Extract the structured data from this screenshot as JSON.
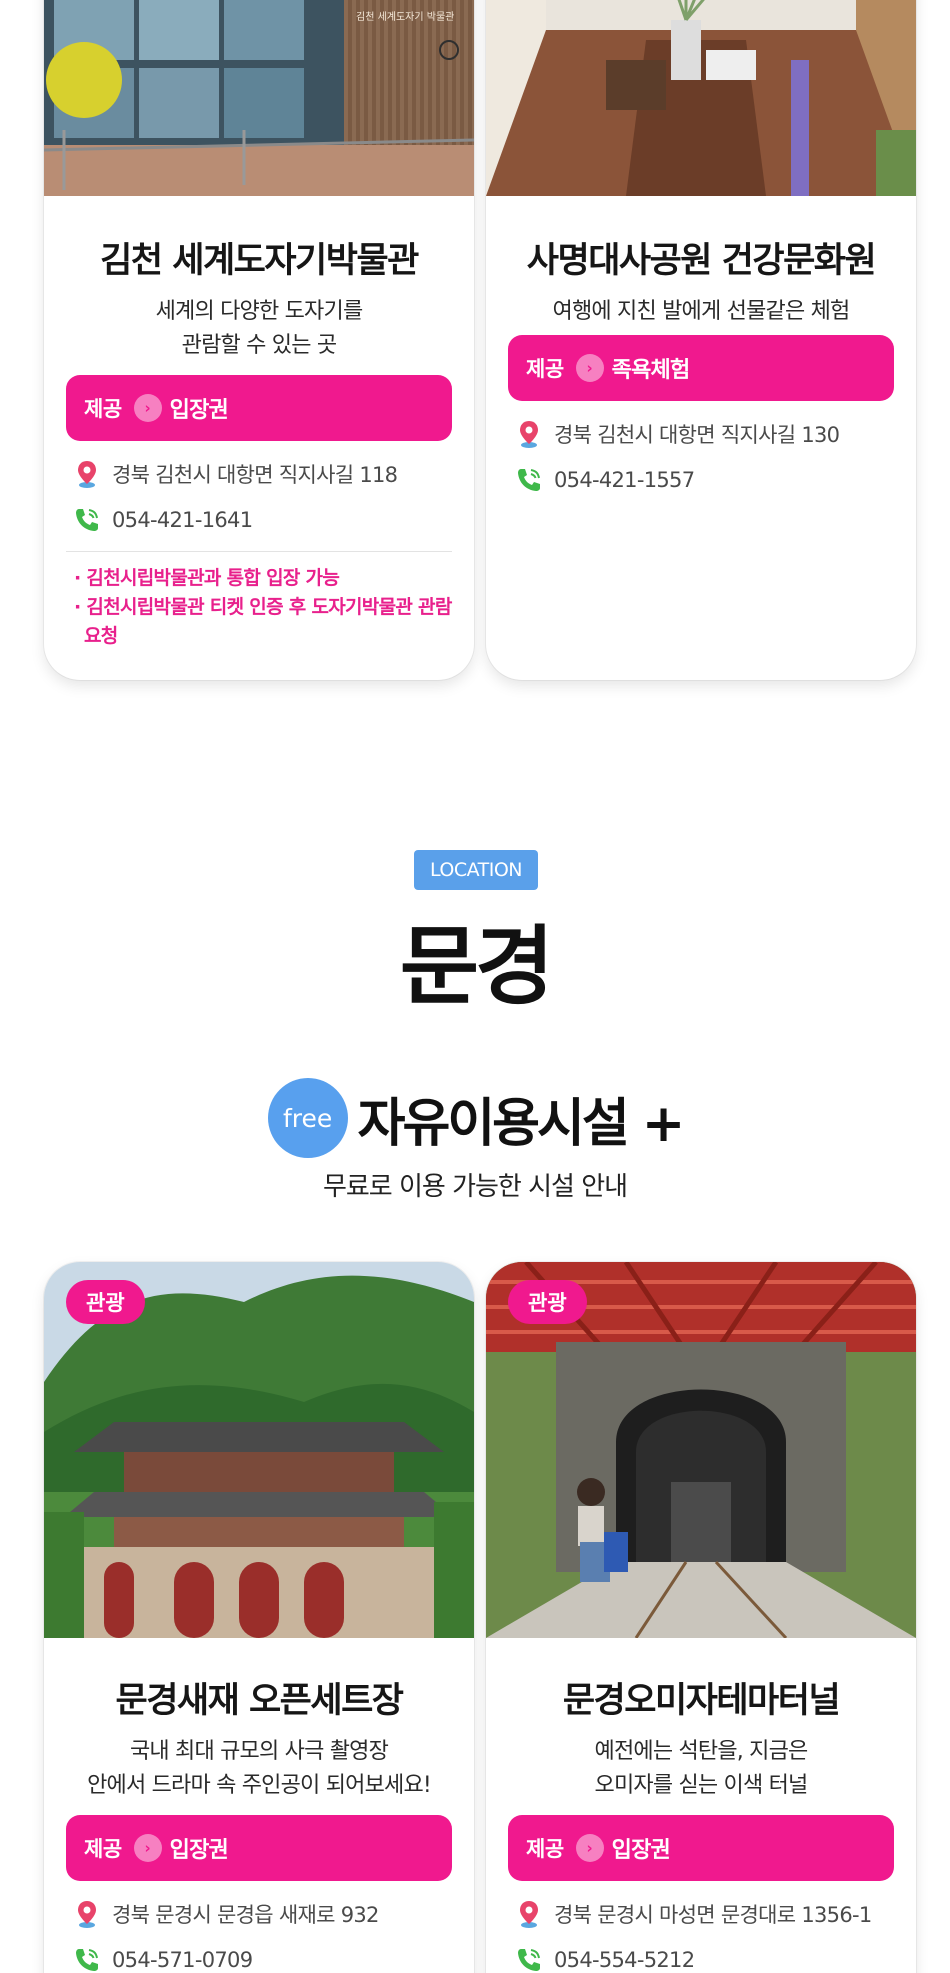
{
  "cards_top": [
    {
      "title": "김천 세계도자기박물관",
      "desc_lines": [
        "세계의 다양한 도자기를",
        "관람할 수 있는 곳"
      ],
      "provide_label": "제공",
      "provide_value": "입장권",
      "address": "경북 김천시 대항면 직지사길 118",
      "phone": "054-421-1641",
      "notes": [
        "· 김천시립박물관과 통합 입장 가능",
        "· 김천시립박물관 티켓 인증 후 도자기박물관 관람 요청"
      ]
    },
    {
      "title": "사명대사공원 건강문화원",
      "desc_lines": [
        "여행에 지친 발에게 선물같은 체험"
      ],
      "provide_label": "제공",
      "provide_value": "족욕체험",
      "address": "경북 김천시 대항면 직지사길 130",
      "phone": "054-421-1557"
    }
  ],
  "location": {
    "badge": "LOCATION",
    "region": "문경"
  },
  "free_section": {
    "badge": "free",
    "title": "자유이용시설 +",
    "subtitle": "무료로 이용 가능한 시설 안내"
  },
  "cards_bottom": [
    {
      "tag": "관광",
      "title": "문경새재 오픈세트장",
      "desc_lines": [
        "국내 최대 규모의 사극 촬영장",
        "안에서 드라마 속 주인공이 되어보세요!"
      ],
      "provide_label": "제공",
      "provide_value": "입장권",
      "address": "경북 문경시 문경읍 새재로 932",
      "phone": "054-571-0709"
    },
    {
      "tag": "관광",
      "title": "문경오미자테마터널",
      "desc_lines": [
        "예전에는 석탄을, 지금은",
        "오미자를 싣는 이색 터널"
      ],
      "provide_label": "제공",
      "provide_value": "입장권",
      "address": "경북 문경시 마성면 문경대로 1356-1",
      "phone": "054-554-5212"
    }
  ],
  "colors": {
    "accent_pink": "#f0198e",
    "accent_blue": "#58a0ee"
  },
  "icons": {
    "location": "map-pin-icon",
    "phone": "phone-icon",
    "arrow": "chevron-right-icon"
  }
}
